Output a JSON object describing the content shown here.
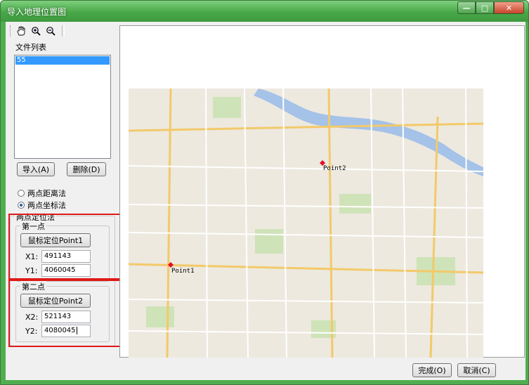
{
  "window": {
    "title": "导入地理位置图"
  },
  "file_list": {
    "title": "文件列表",
    "items": [
      "55"
    ]
  },
  "buttons": {
    "import": "导入(A)",
    "delete": "删除(D)",
    "finish": "完成(O)",
    "cancel": "取消(C)"
  },
  "methods": {
    "options": [
      "两点距离法",
      "两点坐标法"
    ],
    "selected": "两点坐标法"
  },
  "positioning": {
    "group_title": "两点定位法",
    "point1": {
      "title": "第一点",
      "locate_button": "鼠标定位Point1",
      "x_label": "X1:",
      "x_value": "491143",
      "y_label": "Y1:",
      "y_value": "4060045"
    },
    "point2": {
      "title": "第二点",
      "locate_button": "鼠标定位Point2",
      "x_label": "X2:",
      "x_value": "521143",
      "y_label": "Y2:",
      "y_value": "4080045"
    }
  },
  "map": {
    "marker1_label": "Point1",
    "marker2_label": "Point2",
    "marker_color": "#e0102a"
  },
  "colors": {
    "titlebar": "#4fae4f",
    "selection": "#3399ff",
    "highlight": "#e01818"
  }
}
